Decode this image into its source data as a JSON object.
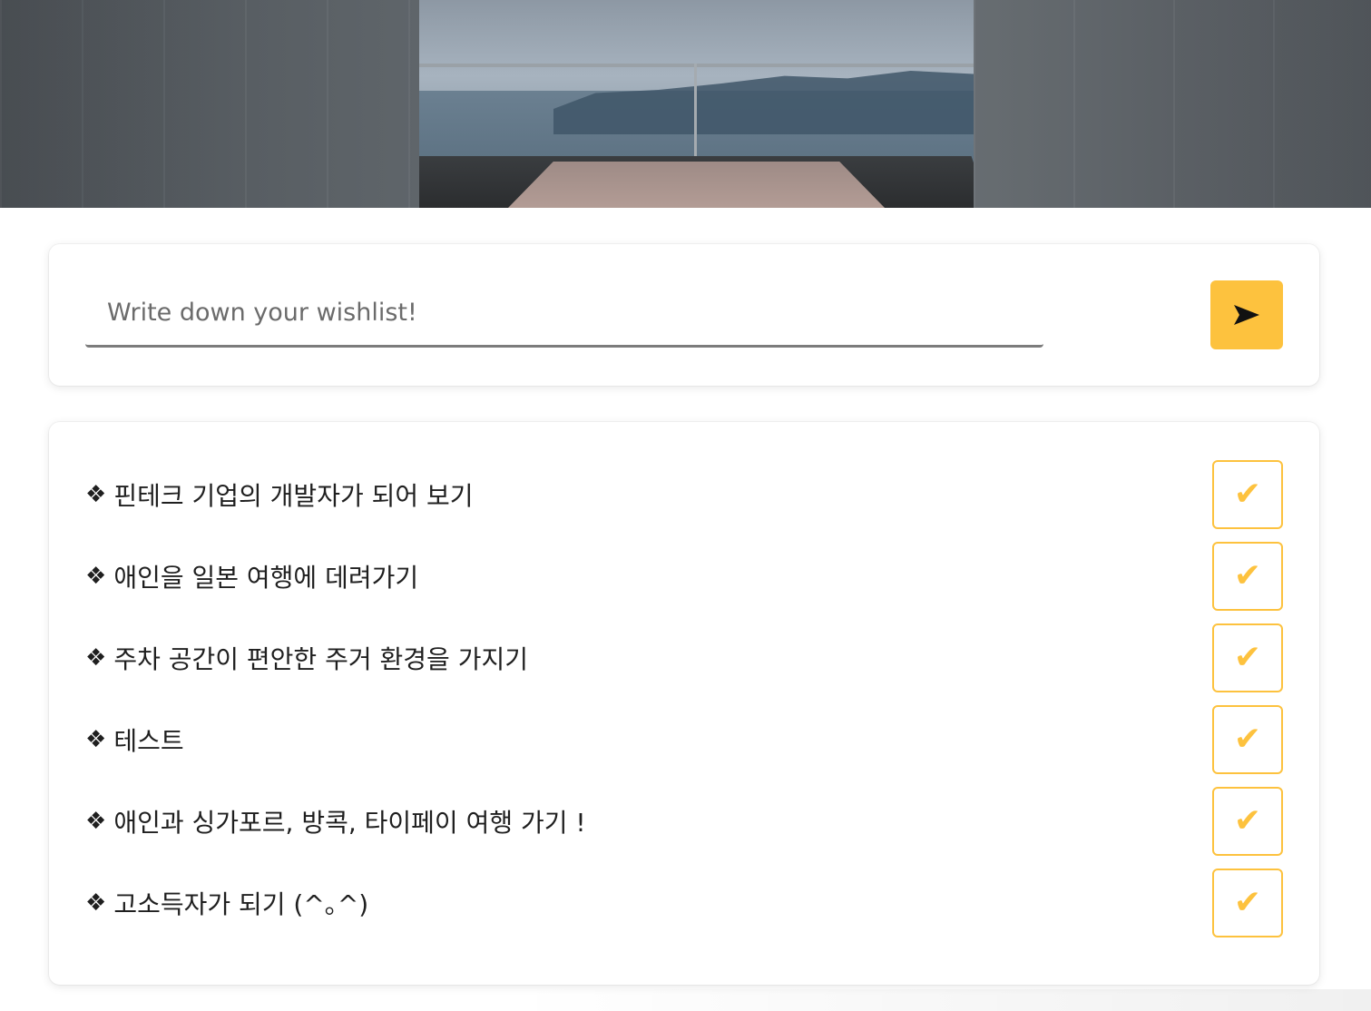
{
  "hero": {
    "title": ""
  },
  "input": {
    "placeholder": "Write down your wishlist!",
    "value": ""
  },
  "send_button": {
    "icon": "send-arrow-icon"
  },
  "wishlist": {
    "bullet": "❖",
    "check_icon": "✔",
    "items": [
      {
        "text": "핀테크 기업의 개발자가 되어 보기"
      },
      {
        "text": "애인을 일본 여행에 데려가기"
      },
      {
        "text": "주차 공간이 편안한 주거 환경을 가지기"
      },
      {
        "text": "테스트"
      },
      {
        "text": "애인과 싱가포르, 방콕, 타이페이 여행 가기 !"
      },
      {
        "text": "고소득자가 되기 (^｡^)"
      }
    ]
  },
  "colors": {
    "accent": "#fdc23e",
    "text": "#1f1f1f",
    "input_underline": "#7c7c7c"
  }
}
